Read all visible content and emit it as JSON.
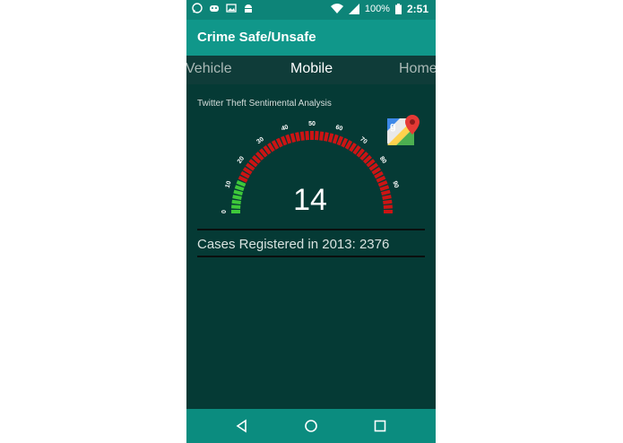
{
  "status_bar": {
    "battery": "100%",
    "time": "2:51",
    "notification_icons": [
      "whatsapp-icon",
      "pig-icon",
      "image-icon",
      "android-icon"
    ],
    "system_icons": [
      "wifi-icon",
      "signal-icon",
      "battery-icon"
    ]
  },
  "app": {
    "title": "Crime Safe/Unsafe"
  },
  "tabs": [
    {
      "label": "Vehicle"
    },
    {
      "label": "Mobile"
    },
    {
      "label": "Home"
    }
  ],
  "gauge": {
    "title": "Twitter Theft Sentimental Analysis",
    "value": "14",
    "scale": [
      "0",
      "10",
      "20",
      "30",
      "40",
      "50",
      "60",
      "70",
      "80",
      "90"
    ],
    "min": 0,
    "max": 100,
    "safe_color": "#3ec83a",
    "unsafe_color": "#cc1414"
  },
  "cases": {
    "text": "Cases Registered in 2013: 2376"
  },
  "colors": {
    "primary": "#10978a",
    "primary_dark": "#0d8478",
    "background": "#053a35"
  }
}
